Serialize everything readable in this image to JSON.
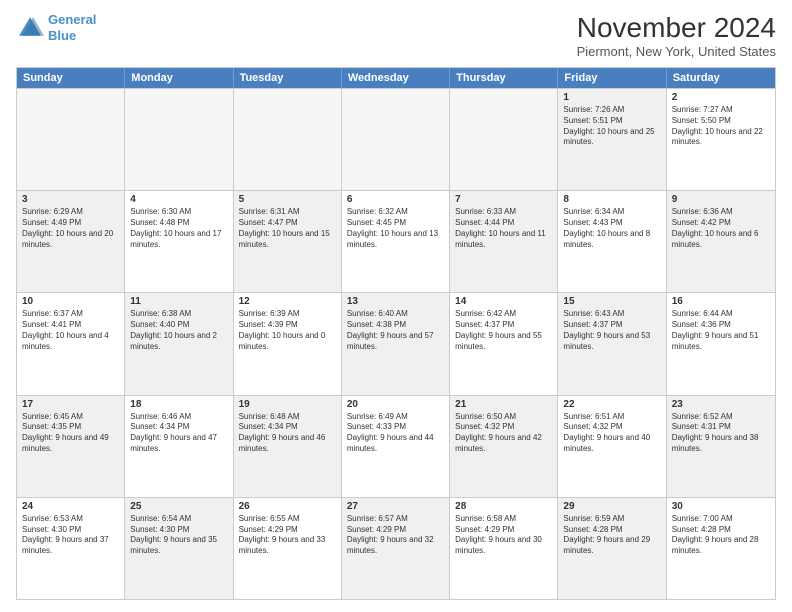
{
  "logo": {
    "line1": "General",
    "line2": "Blue"
  },
  "title": "November 2024",
  "subtitle": "Piermont, New York, United States",
  "header_days": [
    "Sunday",
    "Monday",
    "Tuesday",
    "Wednesday",
    "Thursday",
    "Friday",
    "Saturday"
  ],
  "rows": [
    [
      {
        "day": "",
        "text": "",
        "empty": true
      },
      {
        "day": "",
        "text": "",
        "empty": true
      },
      {
        "day": "",
        "text": "",
        "empty": true
      },
      {
        "day": "",
        "text": "",
        "empty": true
      },
      {
        "day": "",
        "text": "",
        "empty": true
      },
      {
        "day": "1",
        "text": "Sunrise: 7:26 AM\nSunset: 5:51 PM\nDaylight: 10 hours and 25 minutes.",
        "shaded": true
      },
      {
        "day": "2",
        "text": "Sunrise: 7:27 AM\nSunset: 5:50 PM\nDaylight: 10 hours and 22 minutes.",
        "shaded": false
      }
    ],
    [
      {
        "day": "3",
        "text": "Sunrise: 6:29 AM\nSunset: 4:49 PM\nDaylight: 10 hours and 20 minutes.",
        "shaded": true
      },
      {
        "day": "4",
        "text": "Sunrise: 6:30 AM\nSunset: 4:48 PM\nDaylight: 10 hours and 17 minutes.",
        "shaded": false
      },
      {
        "day": "5",
        "text": "Sunrise: 6:31 AM\nSunset: 4:47 PM\nDaylight: 10 hours and 15 minutes.",
        "shaded": true
      },
      {
        "day": "6",
        "text": "Sunrise: 6:32 AM\nSunset: 4:45 PM\nDaylight: 10 hours and 13 minutes.",
        "shaded": false
      },
      {
        "day": "7",
        "text": "Sunrise: 6:33 AM\nSunset: 4:44 PM\nDaylight: 10 hours and 11 minutes.",
        "shaded": true
      },
      {
        "day": "8",
        "text": "Sunrise: 6:34 AM\nSunset: 4:43 PM\nDaylight: 10 hours and 8 minutes.",
        "shaded": false
      },
      {
        "day": "9",
        "text": "Sunrise: 6:36 AM\nSunset: 4:42 PM\nDaylight: 10 hours and 6 minutes.",
        "shaded": true
      }
    ],
    [
      {
        "day": "10",
        "text": "Sunrise: 6:37 AM\nSunset: 4:41 PM\nDaylight: 10 hours and 4 minutes.",
        "shaded": false
      },
      {
        "day": "11",
        "text": "Sunrise: 6:38 AM\nSunset: 4:40 PM\nDaylight: 10 hours and 2 minutes.",
        "shaded": true
      },
      {
        "day": "12",
        "text": "Sunrise: 6:39 AM\nSunset: 4:39 PM\nDaylight: 10 hours and 0 minutes.",
        "shaded": false
      },
      {
        "day": "13",
        "text": "Sunrise: 6:40 AM\nSunset: 4:38 PM\nDaylight: 9 hours and 57 minutes.",
        "shaded": true
      },
      {
        "day": "14",
        "text": "Sunrise: 6:42 AM\nSunset: 4:37 PM\nDaylight: 9 hours and 55 minutes.",
        "shaded": false
      },
      {
        "day": "15",
        "text": "Sunrise: 6:43 AM\nSunset: 4:37 PM\nDaylight: 9 hours and 53 minutes.",
        "shaded": true
      },
      {
        "day": "16",
        "text": "Sunrise: 6:44 AM\nSunset: 4:36 PM\nDaylight: 9 hours and 51 minutes.",
        "shaded": false
      }
    ],
    [
      {
        "day": "17",
        "text": "Sunrise: 6:45 AM\nSunset: 4:35 PM\nDaylight: 9 hours and 49 minutes.",
        "shaded": true
      },
      {
        "day": "18",
        "text": "Sunrise: 6:46 AM\nSunset: 4:34 PM\nDaylight: 9 hours and 47 minutes.",
        "shaded": false
      },
      {
        "day": "19",
        "text": "Sunrise: 6:48 AM\nSunset: 4:34 PM\nDaylight: 9 hours and 46 minutes.",
        "shaded": true
      },
      {
        "day": "20",
        "text": "Sunrise: 6:49 AM\nSunset: 4:33 PM\nDaylight: 9 hours and 44 minutes.",
        "shaded": false
      },
      {
        "day": "21",
        "text": "Sunrise: 6:50 AM\nSunset: 4:32 PM\nDaylight: 9 hours and 42 minutes.",
        "shaded": true
      },
      {
        "day": "22",
        "text": "Sunrise: 6:51 AM\nSunset: 4:32 PM\nDaylight: 9 hours and 40 minutes.",
        "shaded": false
      },
      {
        "day": "23",
        "text": "Sunrise: 6:52 AM\nSunset: 4:31 PM\nDaylight: 9 hours and 38 minutes.",
        "shaded": true
      }
    ],
    [
      {
        "day": "24",
        "text": "Sunrise: 6:53 AM\nSunset: 4:30 PM\nDaylight: 9 hours and 37 minutes.",
        "shaded": false
      },
      {
        "day": "25",
        "text": "Sunrise: 6:54 AM\nSunset: 4:30 PM\nDaylight: 9 hours and 35 minutes.",
        "shaded": true
      },
      {
        "day": "26",
        "text": "Sunrise: 6:55 AM\nSunset: 4:29 PM\nDaylight: 9 hours and 33 minutes.",
        "shaded": false
      },
      {
        "day": "27",
        "text": "Sunrise: 6:57 AM\nSunset: 4:29 PM\nDaylight: 9 hours and 32 minutes.",
        "shaded": true
      },
      {
        "day": "28",
        "text": "Sunrise: 6:58 AM\nSunset: 4:29 PM\nDaylight: 9 hours and 30 minutes.",
        "shaded": false
      },
      {
        "day": "29",
        "text": "Sunrise: 6:59 AM\nSunset: 4:28 PM\nDaylight: 9 hours and 29 minutes.",
        "shaded": true
      },
      {
        "day": "30",
        "text": "Sunrise: 7:00 AM\nSunset: 4:28 PM\nDaylight: 9 hours and 28 minutes.",
        "shaded": false
      }
    ]
  ]
}
